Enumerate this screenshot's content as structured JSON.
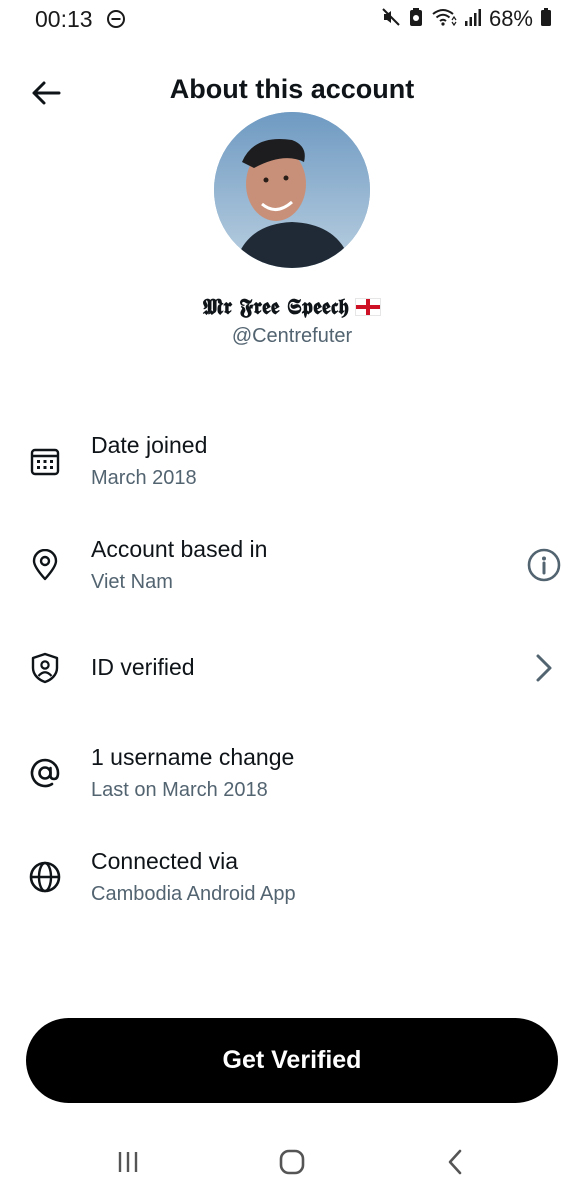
{
  "status_bar": {
    "time": "00:13",
    "battery": "68%"
  },
  "header": {
    "title": "About this account",
    "back_icon": "arrow-left-icon"
  },
  "profile": {
    "display_name": "𝕸𝖗 𝕱𝖗𝖊𝖊 𝕾𝖕𝖊𝖊𝖈𝖍",
    "handle": "@Centrefuter"
  },
  "rows": [
    {
      "icon": "calendar-icon",
      "title": "Date joined",
      "subtitle": "March 2018"
    },
    {
      "icon": "location-pin-icon",
      "title": "Account based in",
      "subtitle": "Viet Nam",
      "action_icon": "info-icon"
    },
    {
      "icon": "shield-user-icon",
      "title": "ID verified",
      "action_icon": "chevron-right-icon"
    },
    {
      "icon": "at-sign-icon",
      "title": "1 username change",
      "subtitle": "Last on March 2018"
    },
    {
      "icon": "globe-icon",
      "title": "Connected via",
      "subtitle": "Cambodia Android App"
    }
  ],
  "cta": {
    "label": "Get Verified"
  },
  "colors": {
    "text_primary": "#0f1419",
    "text_secondary": "#536471",
    "button_bg": "#000000",
    "button_text": "#ffffff"
  }
}
